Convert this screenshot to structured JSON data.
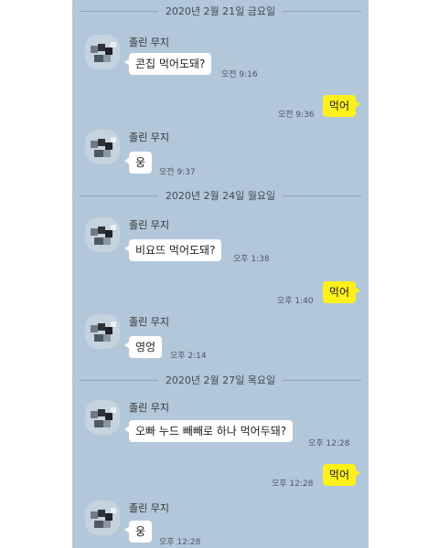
{
  "messages": {
    "date_1": "2020년 2월 21일 금요일",
    "date_2": "2020년 2월 24일 월요일",
    "date_3": "2020년 2월 27일 목요일",
    "sender": "졸린 무지",
    "m1_text": "콘칩 먹어도돼?",
    "m1_time": "오전 9:16",
    "m2_text": "먹어",
    "m2_time": "오전 9:36",
    "m3_text": "웅",
    "m3_time": "오전 9:37",
    "m4_text": "비요뜨 먹어도돼?",
    "m4_time": "오후 1:38",
    "m5_text": "먹어",
    "m5_time": "오후 1:40",
    "m6_text": "영엉",
    "m6_time": "오후 2:14",
    "m7_text": "오빠 누드 빼빼로 하나 먹어두돼?",
    "m7_time": "오후 12:28",
    "m8_text": "먹어",
    "m8_time": "오후 12:28",
    "m9_text": "웅",
    "m9_time": "오후 12:28"
  }
}
